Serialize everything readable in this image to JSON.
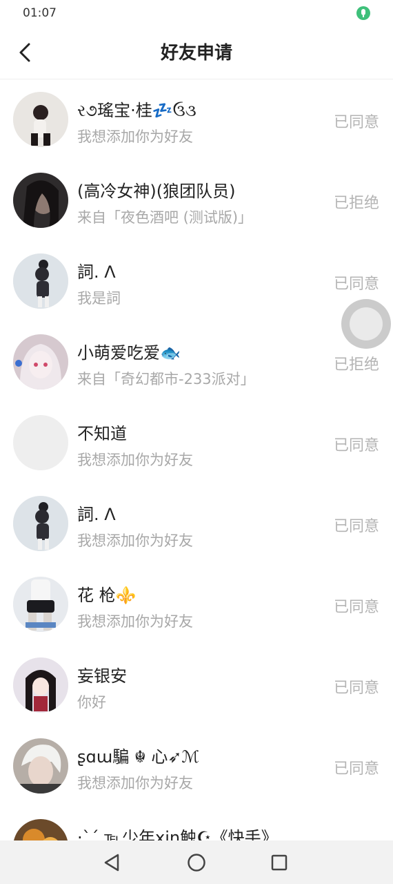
{
  "status_bar": {
    "time": "01:07"
  },
  "header": {
    "title": "好友申请"
  },
  "requests": [
    {
      "name": "ર૭瑤宝·桂💤ઉ૩",
      "message": "我想添加你为好友",
      "status": "已同意"
    },
    {
      "name": "(高冷女神)(狼团队员)",
      "message": "来自「夜色酒吧 (测试版)」",
      "status": "已拒绝"
    },
    {
      "name": "詞. Λ",
      "message": "我是詞",
      "status": "已同意"
    },
    {
      "name": "小萌爱吃爱🐟",
      "message": "来自「奇幻都市-233派对」",
      "status": "已拒绝"
    },
    {
      "name": "不知道",
      "message": "我想添加你为好友",
      "status": "已同意"
    },
    {
      "name": "詞. Λ",
      "message": "我想添加你为好友",
      "status": "已同意"
    },
    {
      "name": "花 枪⚜️",
      "message": "我想添加你为好友",
      "status": "已同意"
    },
    {
      "name": "妄银安",
      "message": "你好",
      "status": "已同意"
    },
    {
      "name": "ʂɑɯ騙 ☬ 心➶ℳ",
      "message": "我想添加你为好友",
      "status": "已同意"
    },
    {
      "name": "·ˋˊ ℡少年xin触☪《快手》",
      "message": "",
      "status": ""
    }
  ],
  "colors": {
    "accent_mic": "#3ec07a",
    "status_text": "#b4b4b4",
    "message_text": "#a8a8a8"
  }
}
